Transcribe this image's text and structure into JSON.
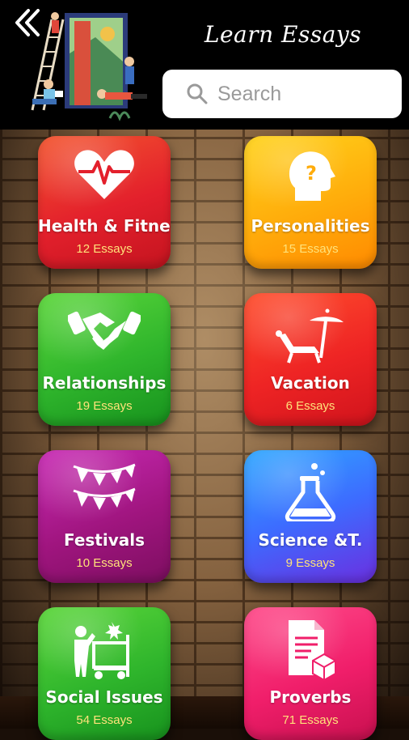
{
  "header": {
    "title": "Learn Essays",
    "search_placeholder": "Search"
  },
  "categories": [
    {
      "label": "Health & Fitnes",
      "count": "12 Essays",
      "icon": "heart-pulse-icon",
      "color": "#e3202c"
    },
    {
      "label": "Personalities",
      "count": "15 Essays",
      "icon": "head-question-icon",
      "color": "#ffac0b"
    },
    {
      "label": "Relationships",
      "count": "19 Essays",
      "icon": "handshake-icon",
      "color": "#2fb52c"
    },
    {
      "label": "Vacation",
      "count": "6 Essays",
      "icon": "beach-chair-icon",
      "color": "#ee2424"
    },
    {
      "label": "Festivals",
      "count": "10 Essays",
      "icon": "bunting-icon",
      "color": "#a0157f"
    },
    {
      "label": "Science &T.",
      "count": "9 Essays",
      "icon": "flask-icon",
      "color": "#3d6bff"
    },
    {
      "label": "Social Issues",
      "count": "54 Essays",
      "icon": "protest-icon",
      "color": "#2fb52c"
    },
    {
      "label": "Proverbs",
      "count": "71 Essays",
      "icon": "document-box-icon",
      "color": "#f01e6a"
    }
  ]
}
